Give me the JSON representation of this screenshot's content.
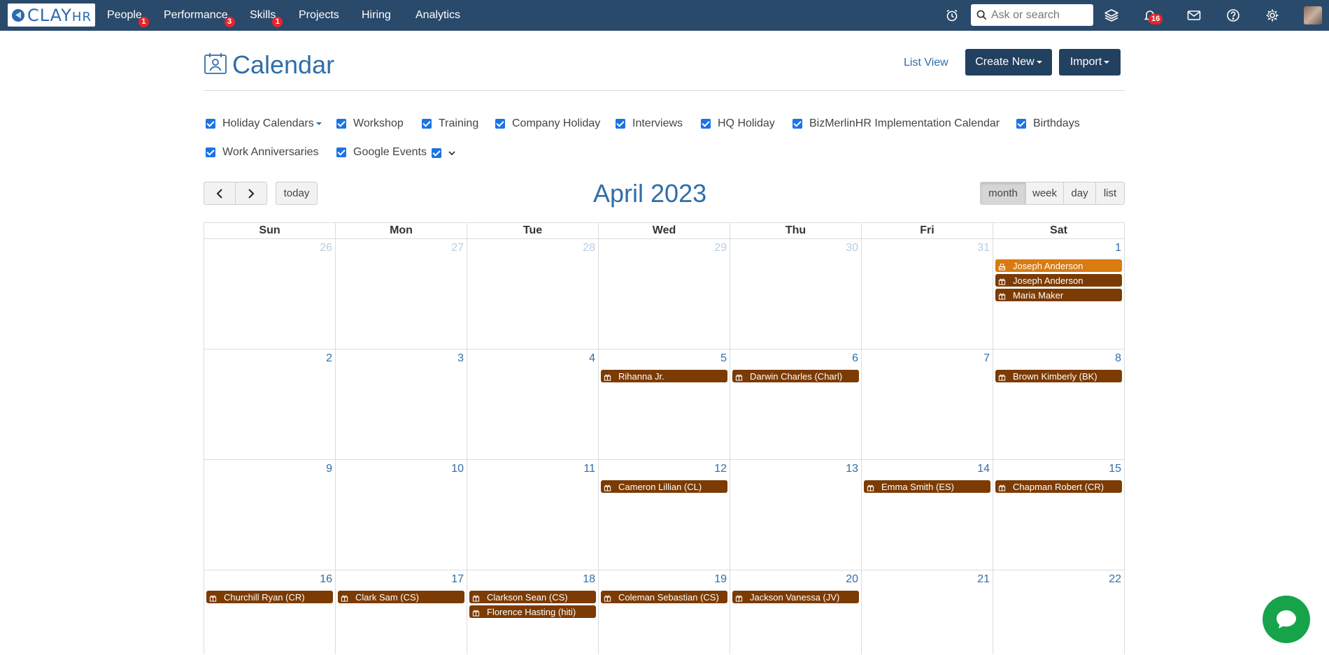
{
  "brand": {
    "name": "CLAY",
    "suffix": "HR"
  },
  "nav": {
    "items": [
      {
        "label": "People",
        "badge": "1"
      },
      {
        "label": "Performance",
        "badge": "3"
      },
      {
        "label": "Skills",
        "badge": "1"
      },
      {
        "label": "Projects",
        "badge": ""
      },
      {
        "label": "Hiring",
        "badge": ""
      },
      {
        "label": "Analytics",
        "badge": ""
      }
    ],
    "search_placeholder": "Ask or search",
    "notification_count": "16",
    "icons": [
      "alarm-clock-icon",
      "search-icon",
      "layers-icon",
      "bell-icon",
      "mail-icon",
      "help-icon",
      "gear-icon"
    ]
  },
  "header": {
    "title": "Calendar",
    "list_view": "List View",
    "create_new": "Create New",
    "import": "Import"
  },
  "filters": [
    {
      "label": "Holiday Calendars",
      "checked": true,
      "dropdown": true
    },
    {
      "label": "Workshop",
      "checked": true
    },
    {
      "label": "Training",
      "checked": true
    },
    {
      "label": "Company Holiday",
      "checked": true
    },
    {
      "label": "Interviews",
      "checked": true
    },
    {
      "label": "HQ Holiday",
      "checked": true
    },
    {
      "label": "BizMerlinHR Implementation Calendar",
      "checked": true
    },
    {
      "label": "Birthdays",
      "checked": true
    },
    {
      "label": "Work Anniversaries",
      "checked": true
    },
    {
      "label": "Google Events",
      "checked": true
    }
  ],
  "toolbar": {
    "today": "today",
    "month_title": "April 2023",
    "views": [
      "month",
      "week",
      "day",
      "list"
    ],
    "active_view": "month"
  },
  "calendar": {
    "days_of_week": [
      "Sun",
      "Mon",
      "Tue",
      "Wed",
      "Thu",
      "Fri",
      "Sat"
    ],
    "weeks": [
      [
        {
          "num": "26",
          "other": true,
          "events": []
        },
        {
          "num": "27",
          "other": true,
          "events": []
        },
        {
          "num": "28",
          "other": true,
          "events": []
        },
        {
          "num": "29",
          "other": true,
          "events": []
        },
        {
          "num": "30",
          "other": true,
          "events": []
        },
        {
          "num": "31",
          "other": true,
          "events": []
        },
        {
          "num": "1",
          "other": false,
          "events": [
            {
              "title": "Joseph Anderson",
              "type": "anniversary"
            },
            {
              "title": "Joseph Anderson",
              "type": "birthday"
            },
            {
              "title": "Maria Maker",
              "type": "birthday"
            }
          ]
        }
      ],
      [
        {
          "num": "2",
          "other": false,
          "events": []
        },
        {
          "num": "3",
          "other": false,
          "events": []
        },
        {
          "num": "4",
          "other": false,
          "events": []
        },
        {
          "num": "5",
          "other": false,
          "events": [
            {
              "title": "Rihanna Jr.",
              "type": "birthday"
            }
          ]
        },
        {
          "num": "6",
          "other": false,
          "events": [
            {
              "title": "Darwin Charles (Charl)",
              "type": "birthday"
            }
          ]
        },
        {
          "num": "7",
          "other": false,
          "events": []
        },
        {
          "num": "8",
          "other": false,
          "events": [
            {
              "title": "Brown Kimberly (BK)",
              "type": "birthday"
            }
          ]
        }
      ],
      [
        {
          "num": "9",
          "other": false,
          "events": []
        },
        {
          "num": "10",
          "other": false,
          "events": []
        },
        {
          "num": "11",
          "other": false,
          "events": []
        },
        {
          "num": "12",
          "other": false,
          "events": [
            {
              "title": "Cameron Lillian (CL)",
              "type": "birthday"
            }
          ]
        },
        {
          "num": "13",
          "other": false,
          "events": []
        },
        {
          "num": "14",
          "other": false,
          "events": [
            {
              "title": "Emma Smith (ES)",
              "type": "birthday"
            }
          ]
        },
        {
          "num": "15",
          "other": false,
          "events": [
            {
              "title": "Chapman Robert (CR)",
              "type": "birthday"
            }
          ]
        }
      ],
      [
        {
          "num": "16",
          "other": false,
          "events": [
            {
              "title": "Churchill Ryan (CR)",
              "type": "birthday"
            }
          ]
        },
        {
          "num": "17",
          "other": false,
          "events": [
            {
              "title": "Clark Sam (CS)",
              "type": "birthday"
            }
          ]
        },
        {
          "num": "18",
          "other": false,
          "events": [
            {
              "title": "Clarkson Sean (CS)",
              "type": "birthday"
            },
            {
              "title": "Florence Hasting (hiti)",
              "type": "birthday"
            }
          ]
        },
        {
          "num": "19",
          "other": false,
          "events": [
            {
              "title": "Coleman Sebastian (CS)",
              "type": "birthday"
            }
          ]
        },
        {
          "num": "20",
          "other": false,
          "events": [
            {
              "title": "Jackson Vanessa (JV)",
              "type": "birthday"
            }
          ]
        },
        {
          "num": "21",
          "other": false,
          "events": []
        },
        {
          "num": "22",
          "other": false,
          "events": []
        }
      ]
    ]
  },
  "colors": {
    "nav_bg": "#2a4a6b",
    "accent_blue": "#2f6ea8",
    "button_dark": "#22405f",
    "birthday_event": "#7b3b03",
    "anniversary_event": "#d97b11",
    "badge_red": "#e8242c",
    "chat_green": "#17a34a"
  }
}
